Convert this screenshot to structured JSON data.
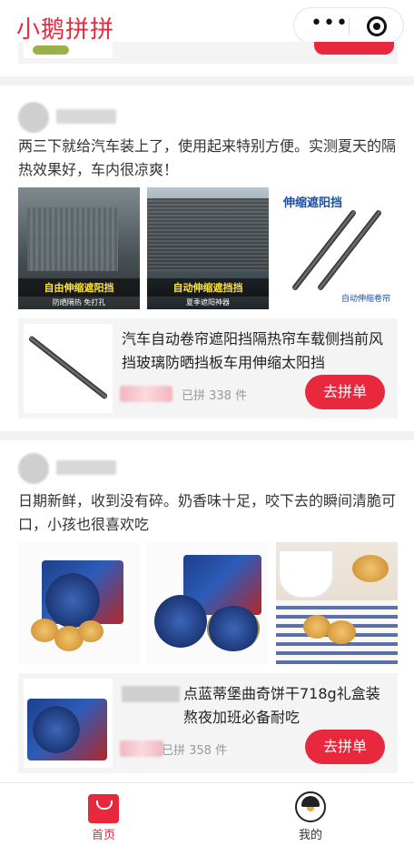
{
  "app": {
    "title": "小鹅拼拼"
  },
  "capsule": {
    "more_icon": "more-dots-icon",
    "close_icon": "target-circle-icon"
  },
  "posts": [
    {
      "text": "两三下就给汽车装上了，使用起来特别方便。实测夏天的隔热效果好，车内很凉爽！",
      "photos": [
        {
          "caption": "自由伸缩遮阳挡",
          "subcaption": "防晒隔热 免打孔"
        },
        {
          "caption": "自动伸缩遮挡挡",
          "subcaption": "夏季遮阳神器"
        },
        {
          "top_caption": "伸缩遮阳挡",
          "bottom_caption": "自动伸缩卷帘"
        }
      ],
      "product": {
        "name": "汽车自动卷帘遮阳挡隔热帘车载侧挡前风挡玻璃防晒挡板车用伸缩太阳挡",
        "joined": "已拼 338 件",
        "buy_label": "去拼单"
      }
    },
    {
      "text": "日期新鲜，收到没有碎。奶香味十足，咬下去的瞬间清脆可口，小孩也很喜欢吃",
      "product": {
        "name": "点蓝蒂堡曲奇饼干718g礼盒装 熬夜加班必备耐吃",
        "joined": "已拼 358 件",
        "buy_label": "去拼单"
      }
    }
  ],
  "tabbar": {
    "items": [
      {
        "label": "首页",
        "icon": "shopping-bag-icon",
        "active": true
      },
      {
        "label": "我的",
        "icon": "penguin-avatar-icon",
        "active": false
      }
    ]
  },
  "colors": {
    "brand": "#e8283c",
    "card_bg": "#f4f4f4",
    "muted_text": "#999999"
  }
}
